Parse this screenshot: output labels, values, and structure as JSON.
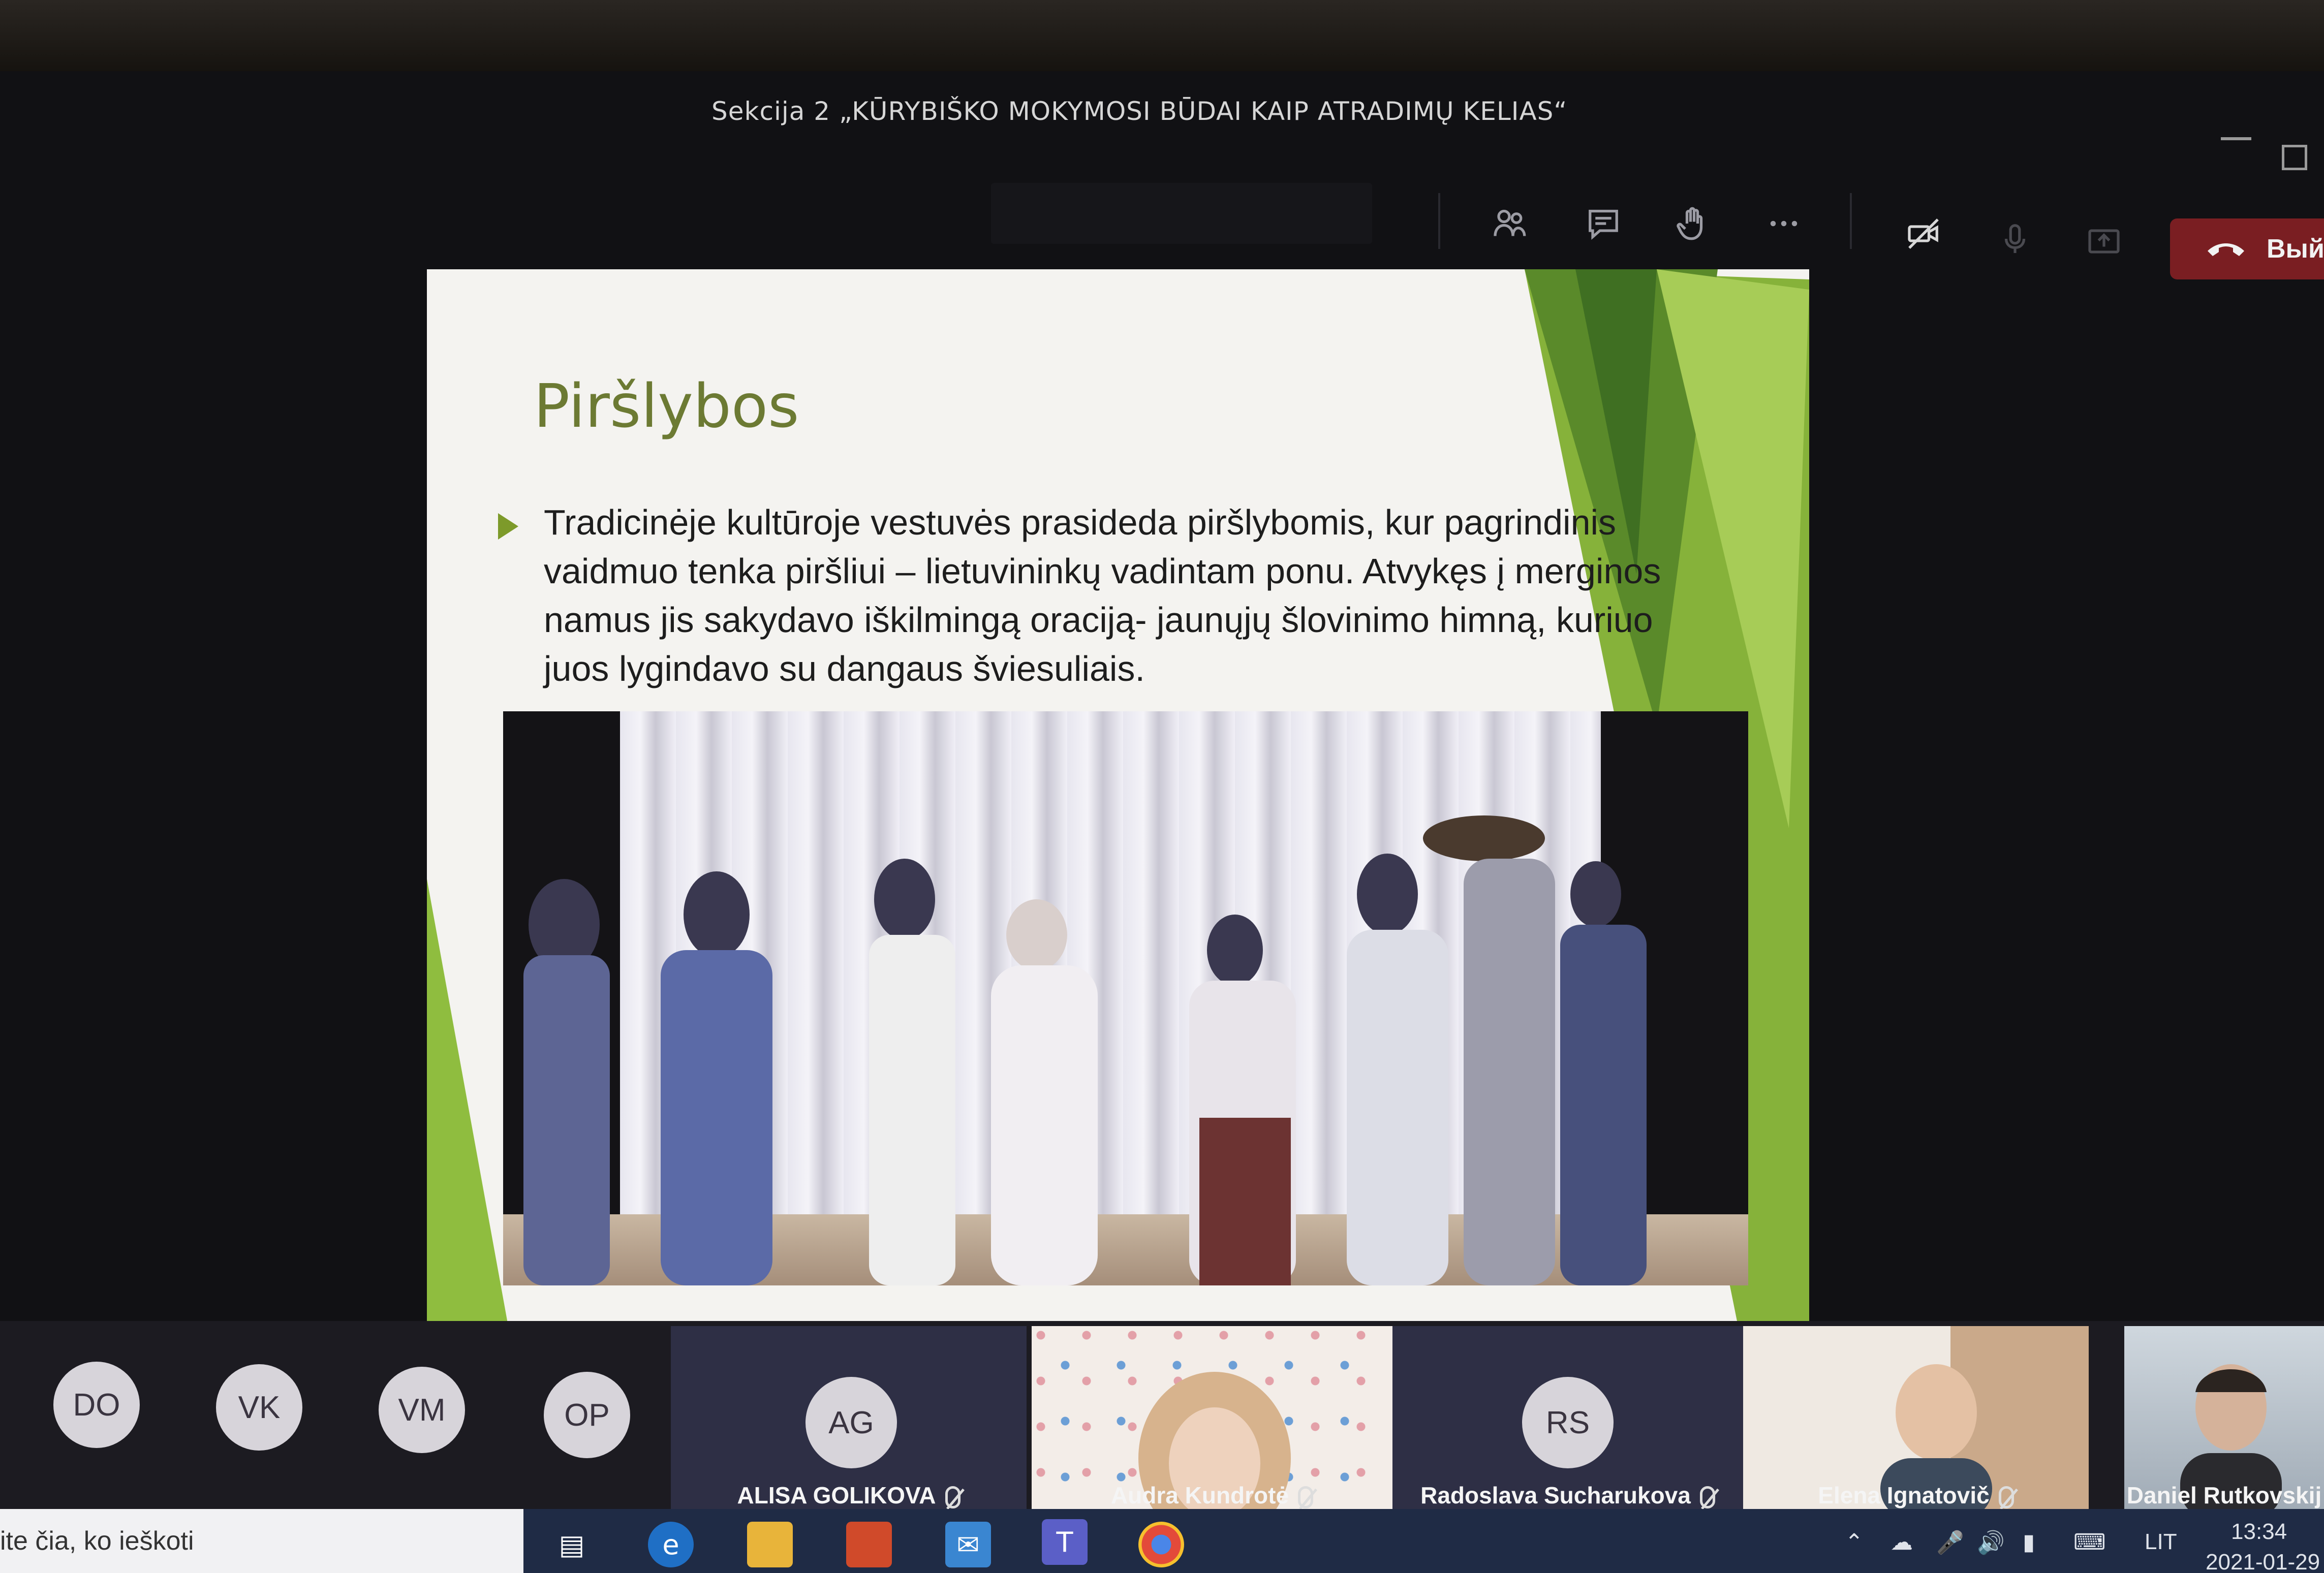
{
  "window": {
    "title": "Sekcija 2 „KŪRYBIŠKO MOKYMOSI BŪDAI KAIP ATRADIMŲ KELIAS“"
  },
  "toolbar": {
    "icons": [
      "participants-icon",
      "chat-icon",
      "raise-hand-icon",
      "more-icon",
      "camera-off-icon",
      "mic-icon",
      "share-icon"
    ],
    "leave_label": "Выйт"
  },
  "slide": {
    "title": "Piršlybos",
    "bullet": "Tradicinėje kultūroje vestuvės prasideda piršlybomis, kur pagrindinis vaidmuo tenka piršliui – lietuvininkų vadintam ponu. Atvykęs į merginos namus jis sakydavo iškilmingą oraciją-  jaunųjų šlovinimo himną, kuriuo juos lygindavo su dangaus šviesuliais.",
    "accent_color": "#7d9a2a",
    "title_color": "#6c7a33"
  },
  "participants": {
    "initials": [
      "DO",
      "VK",
      "VM",
      "OP"
    ],
    "tiles": [
      {
        "initials": "AG",
        "name": "ALISA GOLIKOVA"
      },
      {
        "initials": "",
        "name": "Audra Kundrotė"
      },
      {
        "initials": "RS",
        "name": "Radoslava Sucharukova"
      },
      {
        "initials": "",
        "name": "Elena Ignatovič"
      },
      {
        "initials": "",
        "name": "Daniel Rutkovskij"
      }
    ]
  },
  "taskbar": {
    "search_placeholder": "ite čia, ko ieškoti",
    "language": "LIT",
    "time": "13:34",
    "date": "2021-01-29"
  }
}
